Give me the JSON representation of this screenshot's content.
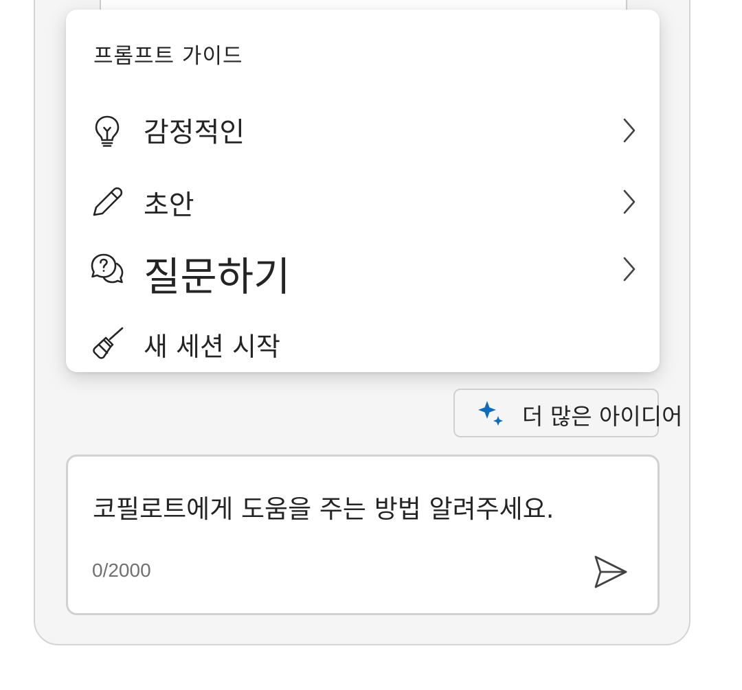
{
  "prompt_guide": {
    "title": "프롬프트 가이드",
    "items": [
      {
        "label": "감정적인",
        "icon": "lightbulb-icon",
        "has_submenu": true
      },
      {
        "label": "초안",
        "icon": "pencil-icon",
        "has_submenu": true
      },
      {
        "label": "질문하기",
        "icon": "question-chat-icon",
        "has_submenu": true
      },
      {
        "label": "새 세션 시작",
        "icon": "broom-icon",
        "has_submenu": false
      }
    ]
  },
  "more_ideas": {
    "label": "더 많은 아이디어",
    "icon": "sparkle-icon"
  },
  "composer": {
    "text": "코필로트에게 도움을 주는 방법 알려주세요.",
    "counter": "0/2000",
    "send_icon": "send-icon"
  },
  "colors": {
    "accent": "#0f6cbd",
    "text": "#242424",
    "panel_bg": "#f5f5f5",
    "border": "#d1d1d1"
  }
}
